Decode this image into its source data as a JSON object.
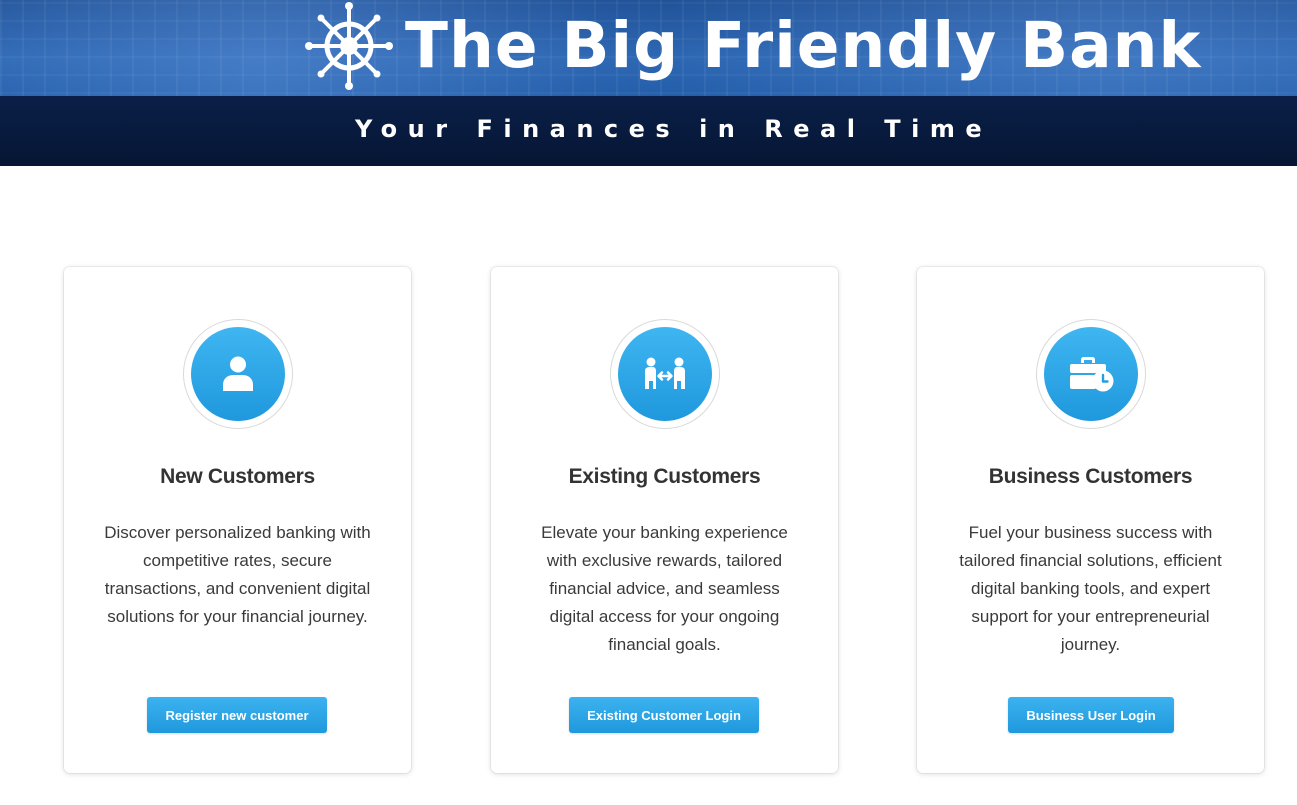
{
  "header": {
    "bank_name": "The Big Friendly Bank",
    "tagline": "Your Finances in Real Time",
    "logo_icon": "ship-wheel-icon"
  },
  "colors": {
    "accent": "#2ba6e8",
    "banner_top": "#1f5aa6",
    "banner_bottom": "#061634",
    "text": "#333333"
  },
  "cards": [
    {
      "icon": "user-icon",
      "title": "New Customers",
      "description": "Discover personalized banking with competitive rates, secure transactions, and convenient digital solutions for your financial journey.",
      "button_label": "Register new customer"
    },
    {
      "icon": "users-exchange-icon",
      "title": "Existing Customers",
      "description": "Elevate your banking experience with exclusive rewards, tailored financial advice, and seamless digital access for your ongoing financial goals.",
      "button_label": "Existing Customer Login"
    },
    {
      "icon": "briefcase-clock-icon",
      "title": "Business Customers",
      "description": "Fuel your business success with tailored financial solutions, efficient digital banking tools, and expert support for your entrepreneurial journey.",
      "button_label": "Business User Login"
    }
  ]
}
